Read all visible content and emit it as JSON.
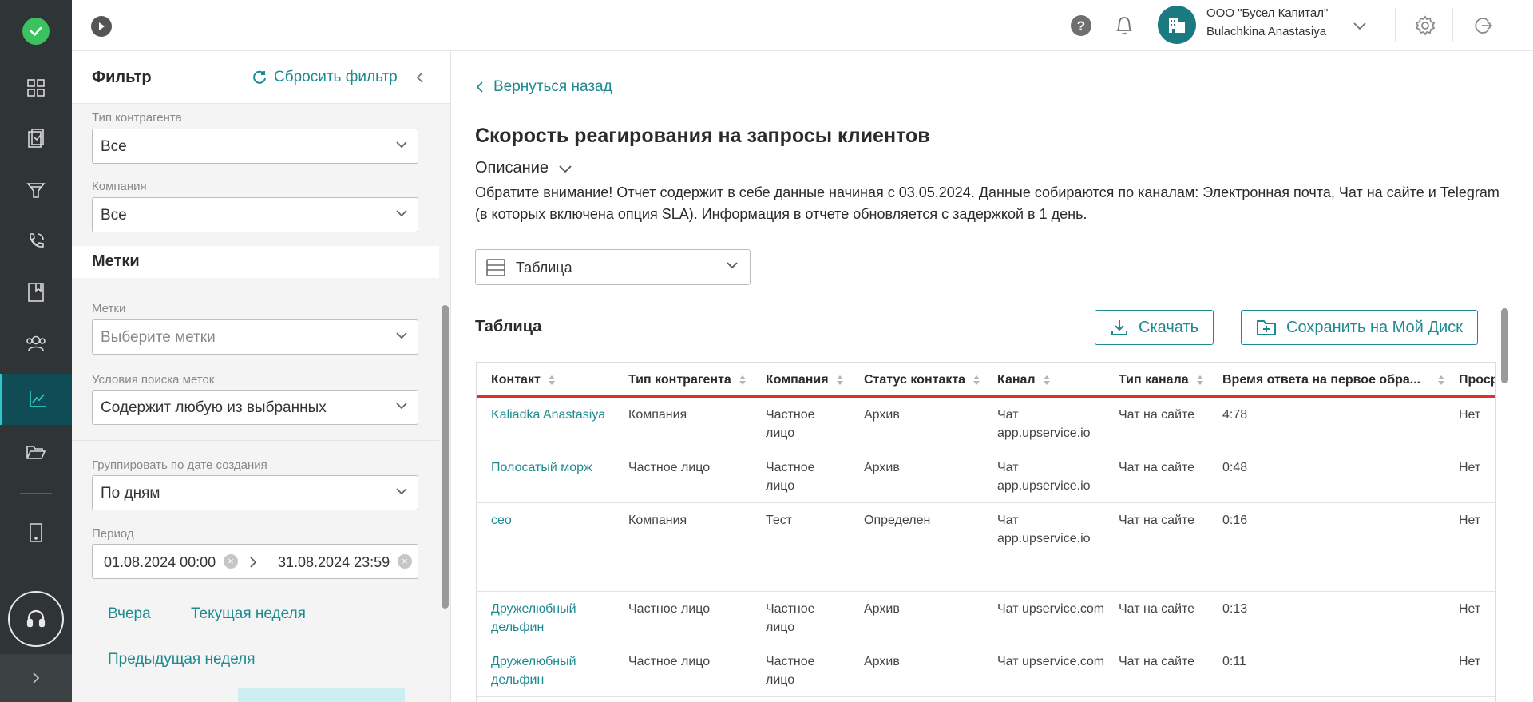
{
  "topbar": {
    "company_name": "ООО \"Бусел Капитал\"",
    "user_name": "Bulachkina Anastasiya"
  },
  "filter": {
    "title": "Фильтр",
    "reset_label": "Сбросить фильтр",
    "counterparty_type": {
      "label": "Тип контрагента",
      "value": "Все"
    },
    "company": {
      "label": "Компания",
      "value": "Все"
    },
    "tags_section_title": "Метки",
    "tags": {
      "label": "Метки",
      "placeholder": "Выберите метки"
    },
    "tag_search": {
      "label": "Условия поиска меток",
      "value": "Содержит любую из выбранных"
    },
    "group_by": {
      "label": "Группировать по дате создания",
      "value": "По дням"
    },
    "period": {
      "label": "Период",
      "from": "01.08.2024 00:00",
      "to": "31.08.2024 23:59"
    },
    "quick": {
      "yesterday": "Вчера",
      "current_week": "Текущая неделя",
      "previous_week": "Предыдущая неделя"
    }
  },
  "main": {
    "back_label": "Вернуться назад",
    "title": "Скорость реагирования на запросы клиентов",
    "description_toggle": "Описание",
    "description_text": "Обратите внимание! Отчет содержит в себе данные начиная с 03.05.2024. Данные собираются по каналам: Электронная почта, Чат на сайте и Telegram (в которых включена опция SLA). Информация в отчете обновляется с задержкой в 1 день.",
    "view_select": "Таблица",
    "table_title": "Таблица",
    "download_label": "Скачать",
    "save_label": "Сохранить на Мой Диск"
  },
  "table": {
    "columns": [
      "Контакт",
      "Тип контрагента",
      "Компания",
      "Статус контакта",
      "Канал",
      "Тип канала",
      "Время ответа на первое обра...",
      "Проср"
    ],
    "rows": [
      {
        "contact": "Kaliadka Anastasiya",
        "type": "Компания",
        "company": "Частное лицо",
        "status": "Архив",
        "channel": "Чат app.upservice.io",
        "channel_type": "Чат на сайте",
        "time": "4:78",
        "overdue": "Нет"
      },
      {
        "contact": "Полосатый морж",
        "type": "Частное лицо",
        "company": "Частное лицо",
        "status": "Архив",
        "channel": "Чат app.upservice.io",
        "channel_type": "Чат на сайте",
        "time": "0:48",
        "overdue": "Нет"
      },
      {
        "contact": "ceo",
        "type": "Компания",
        "company": "Тест",
        "status": "Определен",
        "channel": "Чат app.upservice.io",
        "channel_type": "Чат на сайте",
        "time": "0:16",
        "overdue": "Нет"
      },
      {
        "contact": "Дружелюбный дельфин",
        "type": "Частное лицо",
        "company": "Частное лицо",
        "status": "Архив",
        "channel": "Чат upservice.com",
        "channel_type": "Чат на сайте",
        "time": "0:13",
        "overdue": "Нет"
      },
      {
        "contact": "Дружелюбный дельфин",
        "type": "Частное лицо",
        "company": "Частное лицо",
        "status": "Архив",
        "channel": "Чат upservice.com",
        "channel_type": "Чат на сайте",
        "time": "0:11",
        "overdue": "Нет"
      }
    ]
  },
  "colors": {
    "accent": "#1d8a90",
    "rail": "#2f3437",
    "header_underline": "#d9322f",
    "logo": "#3cc15f"
  }
}
